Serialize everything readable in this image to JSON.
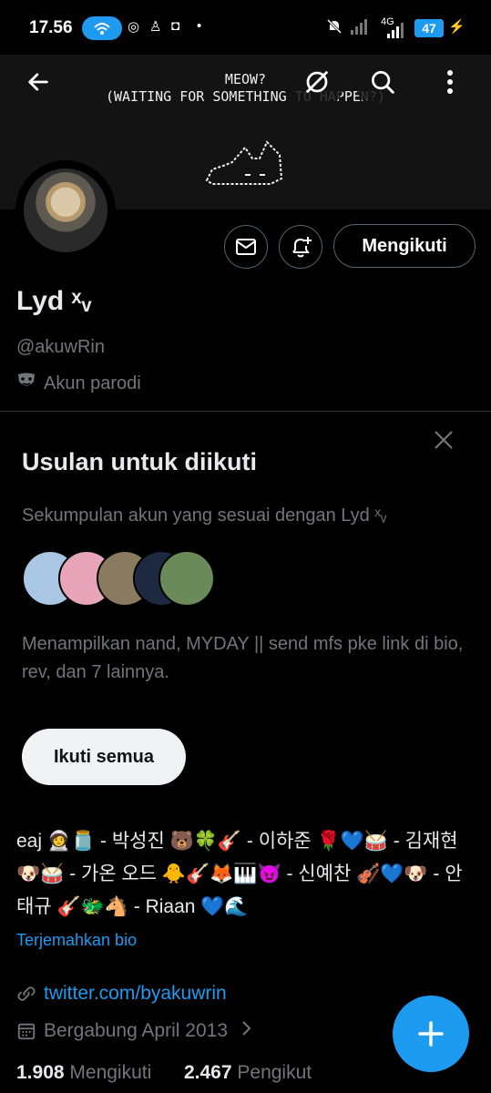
{
  "status_bar": {
    "time": "17.56",
    "battery": "47"
  },
  "header": {
    "banner_text_line1": "MEOW?",
    "banner_text_line2": "(WAITING FOR SOMETHING TO HAPPEN?)",
    "back_icon": "arrow-left-icon",
    "grok_icon": "slashed-circle-icon",
    "search_icon": "search-icon",
    "more_icon": "more-vertical-icon"
  },
  "profile": {
    "name": "Lyd ˣᵥ",
    "handle": "@akuwRin",
    "parody_label": "Akun parodi",
    "follow_label": "Mengikuti"
  },
  "suggestions": {
    "title": "Usulan untuk diikuti",
    "subtitle": "Sekumpulan akun yang sesuai dengan Lyd ˣᵥ",
    "description": "Menampilkan nand, MYDAY || send mfs pke link di bio, rev, dan 7 lainnya.",
    "follow_all_label": "Ikuti semua",
    "face_colors": [
      "#a9c6e4",
      "#e8a4b8",
      "#8a7a60",
      "#1c2940",
      "#6a8a5a"
    ]
  },
  "bio": {
    "text": "eaj 🧑‍🚀🫙 - 박성진 🐻🍀🎸 - 이하준 🌹💙🥁 - 김재현 🐶🥁 - 가온 오드 🐥🎸🦊🎹😈 - 신예찬 🎻💙🐶 - 안태규 🎸🐲🐴 - Riaan 💙🌊",
    "translate_label": "Terjemahkan bio"
  },
  "meta": {
    "website": "twitter.com/byakuwrin",
    "joined": "Bergabung April 2013"
  },
  "counts": {
    "following_value": "1.908",
    "following_label": "Mengikuti",
    "followers_value": "2.467",
    "followers_label": "Pengikut"
  },
  "colors": {
    "accent": "#1d9bf0",
    "muted": "#71767b",
    "text": "#e7e9ea",
    "background": "#000000"
  }
}
